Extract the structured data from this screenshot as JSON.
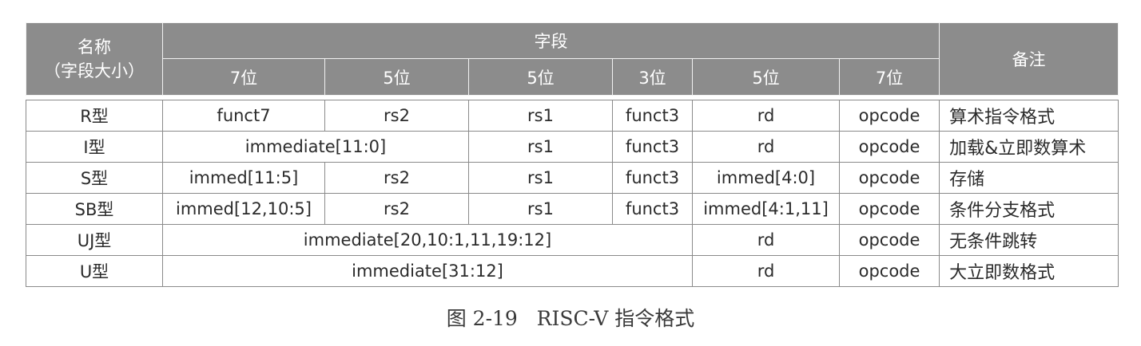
{
  "header": {
    "name_title": "名称",
    "name_subtitle": "（字段大小）",
    "fields_title": "字段",
    "note_title": "备注",
    "widths": [
      "7位",
      "5位",
      "5位",
      "3位",
      "5位",
      "7位"
    ]
  },
  "rows": [
    {
      "name": "R型",
      "funct7": "funct7",
      "rs2": "rs2",
      "rs1": "rs1",
      "funct3": "funct3",
      "rd": "rd",
      "opcode": "opcode",
      "note": "算术指令格式"
    },
    {
      "name": "I型",
      "imm": "immediate[11:0]",
      "rs1": "rs1",
      "funct3": "funct3",
      "rd": "rd",
      "opcode": "opcode",
      "note": "加载&立即数算术"
    },
    {
      "name": "S型",
      "imm_hi": "immed[11:5]",
      "rs2": "rs2",
      "rs1": "rs1",
      "funct3": "funct3",
      "imm_lo": "immed[4:0]",
      "opcode": "opcode",
      "note": "存储"
    },
    {
      "name": "SB型",
      "imm_hi": "immed[12,10:5]",
      "rs2": "rs2",
      "rs1": "rs1",
      "funct3": "funct3",
      "imm_lo": "immed[4:1,11]",
      "opcode": "opcode",
      "note": "条件分支格式"
    },
    {
      "name": "UJ型",
      "imm": "immediate[20,10:1,11,19:12]",
      "rd": "rd",
      "opcode": "opcode",
      "note": "无条件跳转"
    },
    {
      "name": "U型",
      "imm": "immediate[31:12]",
      "rd": "rd",
      "opcode": "opcode",
      "note": "大立即数格式"
    }
  ],
  "caption": "图 2-19   RISC-V 指令格式"
}
